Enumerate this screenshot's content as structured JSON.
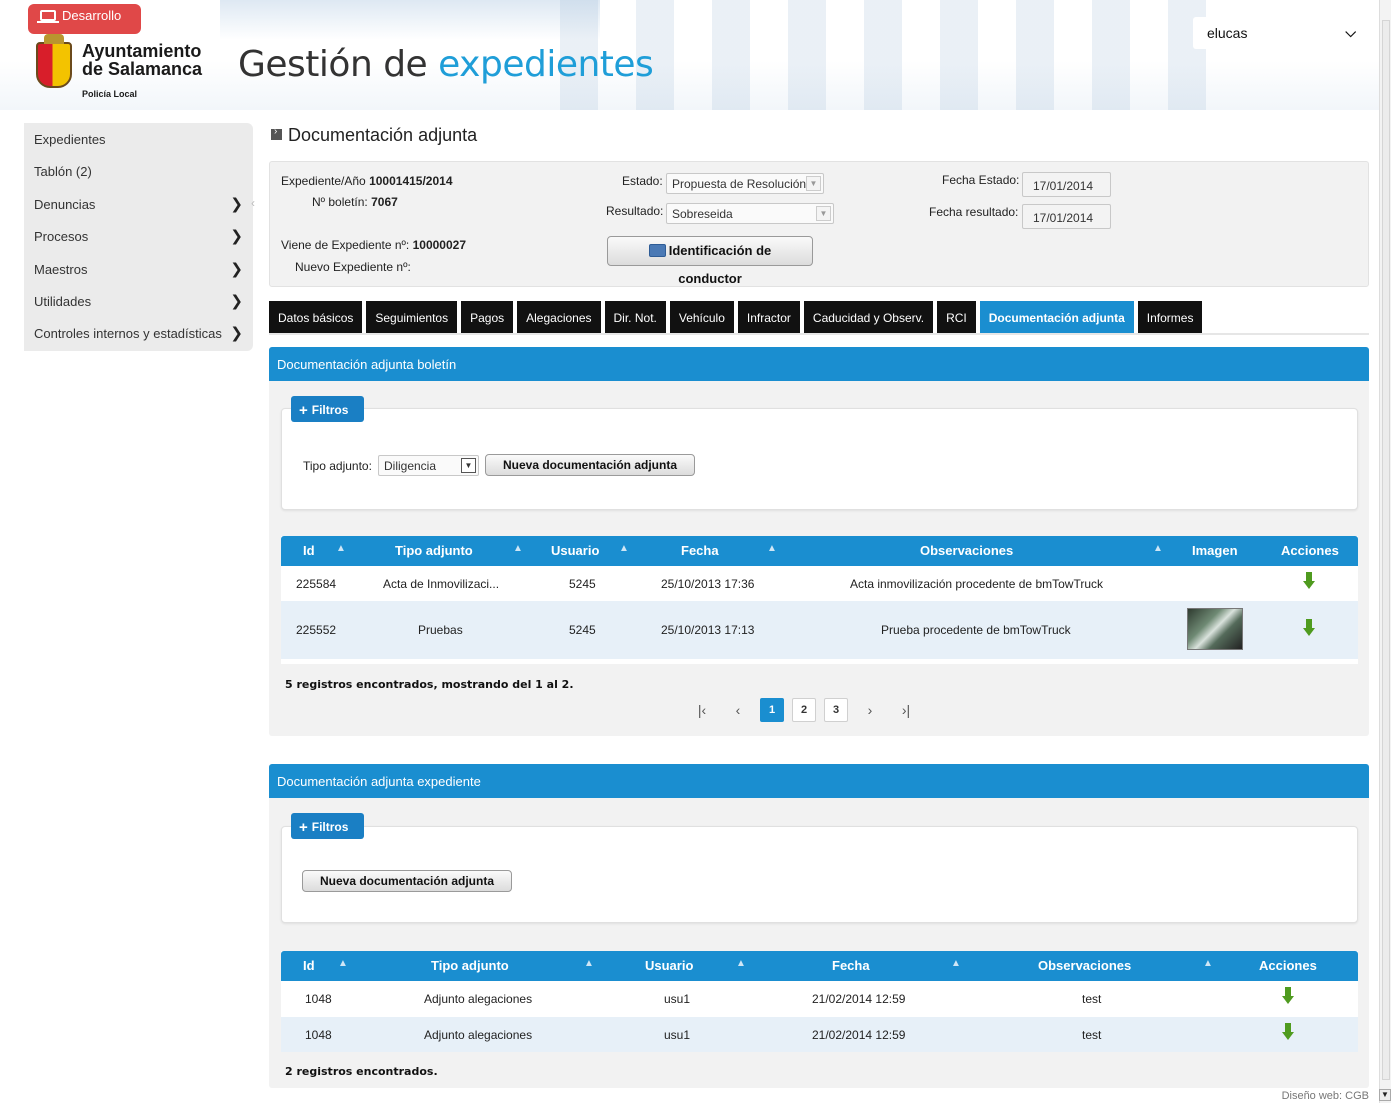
{
  "header": {
    "env_badge": "Desarrollo",
    "logo_title_line1": "Ayuntamiento",
    "logo_title_line2": "de Salamanca",
    "logo_subtitle": "Policía Local",
    "app_title_main": "Gestión de ",
    "app_title_accent": "expedientes",
    "user": "elucas"
  },
  "sidebar": {
    "items": [
      {
        "label": "Expedientes",
        "has_arrow": false
      },
      {
        "label": "Tablón (2)",
        "has_arrow": false
      },
      {
        "label": "Denuncias",
        "has_arrow": true
      },
      {
        "label": "Procesos",
        "has_arrow": true
      },
      {
        "label": "Maestros",
        "has_arrow": true
      },
      {
        "label": "Utilidades",
        "has_arrow": true
      },
      {
        "label": "Controles internos y estadísticas",
        "has_arrow": true
      }
    ]
  },
  "page_title": "Documentación adjunta",
  "info": {
    "expediente_label": "Expediente/Año",
    "expediente_value": "10001415/2014",
    "boletin_label": "Nº boletín:",
    "boletin_value": "7067",
    "viene_label": "Viene de Expediente nº:",
    "viene_value": "10000027",
    "nuevo_label": "Nuevo Expediente nº:",
    "estado_label": "Estado:",
    "estado_value": "Propuesta de Resolución",
    "resultado_label": "Resultado:",
    "resultado_value": "Sobreseida",
    "fecha_estado_label": "Fecha Estado:",
    "fecha_estado_value": "17/01/2014",
    "fecha_resultado_label": "Fecha resultado:",
    "fecha_resultado_value": "17/01/2014",
    "identificacion_button": "Identificación de conductor"
  },
  "tabs": [
    {
      "label": "Datos básicos",
      "active": false
    },
    {
      "label": "Seguimientos",
      "active": false
    },
    {
      "label": "Pagos",
      "active": false
    },
    {
      "label": "Alegaciones",
      "active": false
    },
    {
      "label": "Dir. Not.",
      "active": false
    },
    {
      "label": "Vehículo",
      "active": false
    },
    {
      "label": "Infractor",
      "active": false
    },
    {
      "label": "Caducidad y Observ.",
      "active": false
    },
    {
      "label": "RCI",
      "active": false
    },
    {
      "label": "Documentación adjunta",
      "active": true
    },
    {
      "label": "Informes",
      "active": false
    }
  ],
  "section1": {
    "title": "Documentación adjunta boletín",
    "filter_button": "Filtros",
    "tipo_label": "Tipo adjunto:",
    "tipo_value": "Diligencia",
    "new_button": "Nueva documentación adjunta",
    "columns": [
      "Id",
      "Tipo adjunto",
      "Usuario",
      "Fecha",
      "Observaciones",
      "Imagen",
      "Acciones"
    ],
    "rows": [
      {
        "id": "225584",
        "tipo": "Acta de Inmovilizaci...",
        "usuario": "5245",
        "fecha": "25/10/2013 17:36",
        "observaciones": "Acta inmovilización procedente de bmTowTruck",
        "imagen": false
      },
      {
        "id": "225552",
        "tipo": "Pruebas",
        "usuario": "5245",
        "fecha": "25/10/2013 17:13",
        "observaciones": "Prueba procedente de bmTowTruck",
        "imagen": true
      }
    ],
    "records": "5 registros encontrados, mostrando del 1 al 2.",
    "pages": [
      "1",
      "2",
      "3"
    ],
    "current_page": "1"
  },
  "section2": {
    "title": "Documentación adjunta expediente",
    "filter_button": "Filtros",
    "new_button": "Nueva documentación adjunta",
    "columns": [
      "Id",
      "Tipo adjunto",
      "Usuario",
      "Fecha",
      "Observaciones",
      "Acciones"
    ],
    "rows": [
      {
        "id": "1048",
        "tipo": "Adjunto alegaciones",
        "usuario": "usu1",
        "fecha": "21/02/2014 12:59",
        "observaciones": "test"
      },
      {
        "id": "1048",
        "tipo": "Adjunto alegaciones",
        "usuario": "usu1",
        "fecha": "21/02/2014 12:59",
        "observaciones": "test"
      }
    ],
    "records": "2 registros encontrados."
  },
  "footer": {
    "credit": "Diseño web: CGB"
  },
  "colors": {
    "primary_blue": "#1a8ed0",
    "badge_red": "#e04848",
    "tab_black": "#111111",
    "download_green": "#4f9b1f",
    "alt_row": "#e7f0f8"
  },
  "icons": {
    "env_badge": "laptop-icon",
    "user_select": "chevron-down-icon",
    "sidebar_arrow": "chevron-right-icon",
    "page_title": "square-bullet-icon",
    "identificacion": "id-card-icon",
    "filter": "plus-icon",
    "sort": "sort-icon",
    "action": "download-arrow-icon"
  }
}
